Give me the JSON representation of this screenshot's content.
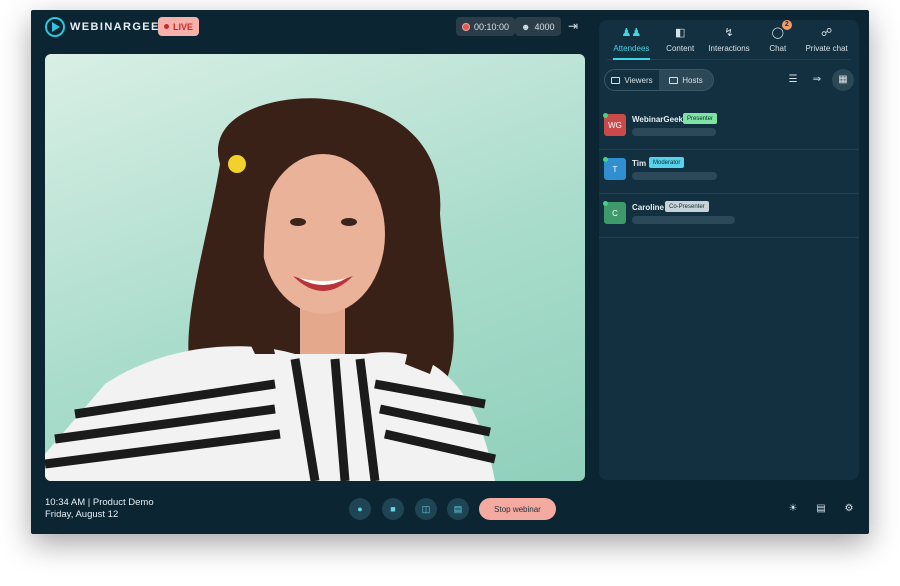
{
  "header": {
    "logo_text": "WEBINARGEEK",
    "live_label": "LIVE",
    "recording_time": "00:10:00",
    "attendee_count": "4000",
    "exit_icon": "exit-icon"
  },
  "colors": {
    "accent": "#3fd6e6",
    "live": "#c62d2d",
    "stop_button": "#f4aaa0",
    "background": "#0b2533"
  },
  "sidebar": {
    "tabs": [
      {
        "label": "Attendees",
        "icon": "people-icon",
        "active": true
      },
      {
        "label": "Content",
        "icon": "folder-icon",
        "active": false
      },
      {
        "label": "Interactions",
        "icon": "bolt-icon",
        "active": false
      },
      {
        "label": "Chat",
        "icon": "chat-icon",
        "active": false,
        "badge": "2"
      },
      {
        "label": "Private chat",
        "icon": "private-chat-icon",
        "active": false
      }
    ],
    "toggle": {
      "viewers_label": "Viewers",
      "hosts_label": "Hosts",
      "selected": "Hosts"
    },
    "hosts": [
      {
        "initials": "WG",
        "name": "WebinarGeek",
        "role": "Presenter",
        "avatar_color": "#c94a4a",
        "role_color": "#7fe3a3"
      },
      {
        "initials": "T",
        "name": "Tim",
        "role": "Moderator",
        "avatar_color": "#2f8fd0",
        "role_color": "#58d2ea"
      },
      {
        "initials": "C",
        "name": "Caroline",
        "role": "Co-Presenter",
        "avatar_color": "#3e9a6a",
        "role_color": "#c7d3d8"
      }
    ]
  },
  "footer": {
    "time_title": "10:34 AM | Product Demo",
    "date": "Friday, August 12",
    "stop_label": "Stop webinar"
  }
}
